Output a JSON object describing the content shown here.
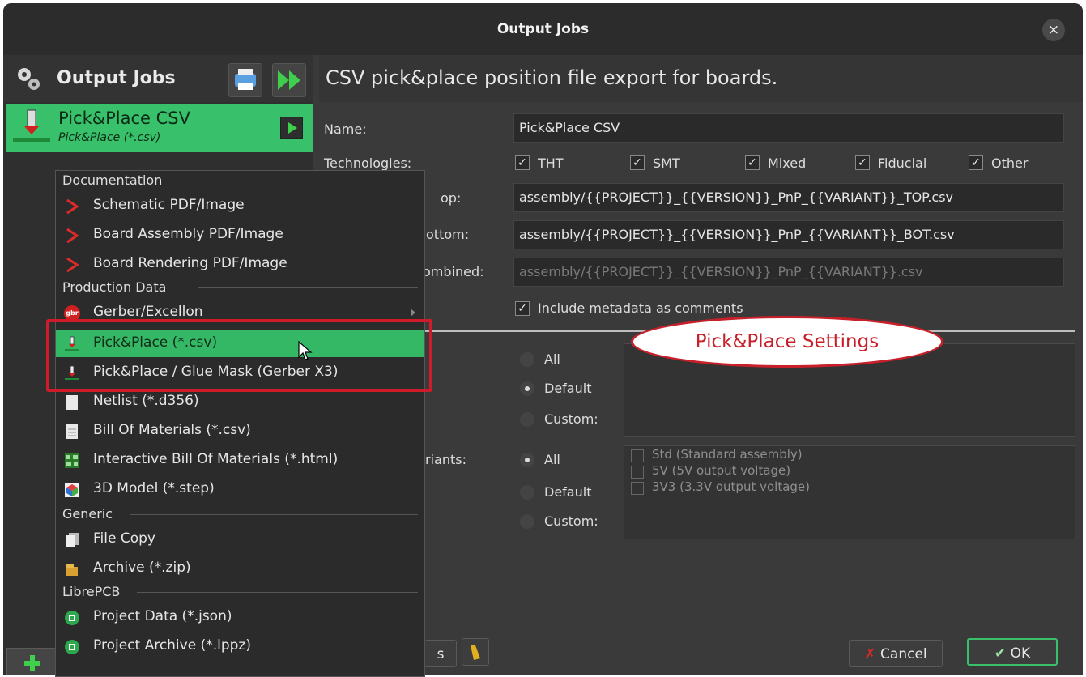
{
  "window": {
    "title": "Output Jobs",
    "close_label": "×"
  },
  "left": {
    "title": "Output Jobs",
    "job": {
      "name": "Pick&Place CSV",
      "sub": "Pick&Place (*.csv)"
    }
  },
  "right": {
    "header": "CSV pick&place position file export for boards.",
    "name_label": "Name:",
    "name_value": "Pick&Place CSV",
    "tech_label": "Technologies:",
    "tech": [
      "THT",
      "SMT",
      "Mixed",
      "Fiducial",
      "Other"
    ],
    "top_label_partial": "op:",
    "top_value": "assembly/{{PROJECT}}_{{VERSION}}_PnP_{{VARIANT}}_TOP.csv",
    "bottom_label_partial": "ottom:",
    "bottom_value": "assembly/{{PROJECT}}_{{VERSION}}_PnP_{{VARIANT}}_BOT.csv",
    "combined_label_partial": "ombined:",
    "combined_value": "assembly/{{PROJECT}}_{{VERSION}}_PnP_{{VARIANT}}.csv",
    "metadata_label": "Include metadata as comments",
    "boards_radios": [
      "All",
      "Default",
      "Custom:"
    ],
    "variants_label_partial": "riants:",
    "variants_radios": [
      "All",
      "Default",
      "Custom:"
    ],
    "variants_list": [
      "Std (Standard assembly)",
      "5V (5V output voltage)",
      "3V3 (3.3V output voltage)"
    ],
    "bubble": "Pick&Place Settings",
    "partial_button": "s",
    "cancel": "Cancel",
    "ok": "OK"
  },
  "menu": {
    "sections": [
      {
        "title": "Documentation",
        "items": [
          "Schematic PDF/Image",
          "Board Assembly PDF/Image",
          "Board Rendering PDF/Image"
        ]
      },
      {
        "title": "Production Data",
        "items": [
          "Gerber/Excellon",
          "Pick&Place (*.csv)",
          "Pick&Place / Glue Mask (Gerber X3)",
          "Netlist (*.d356)",
          "Bill Of Materials (*.csv)",
          "Interactive Bill Of Materials (*.html)",
          "3D Model (*.step)"
        ]
      },
      {
        "title": "Generic",
        "items": [
          "File Copy",
          "Archive (*.zip)"
        ]
      },
      {
        "title": "LibrePCB",
        "items": [
          "Project Data (*.json)",
          "Project Archive (*.lppz)"
        ]
      }
    ],
    "gerber_icon_text": "gbr"
  },
  "colors": {
    "accent": "#38c16a",
    "annotation": "#d01c2a"
  }
}
